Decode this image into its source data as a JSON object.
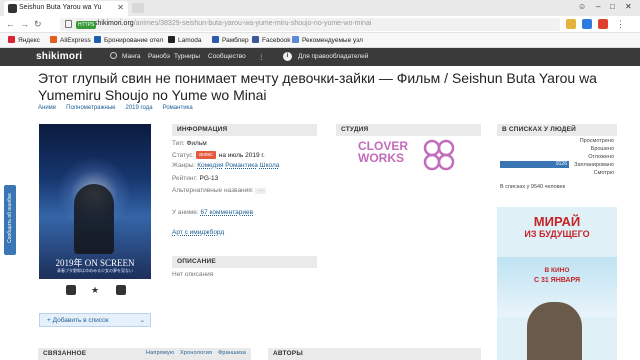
{
  "browser": {
    "tab_title": "Seishun Buta Yarou wa Yu",
    "url_https": "HTTPS",
    "url_domain": "shikimori.org",
    "url_path": "/animes/38329-seishun-buta-yarou-wa-yume-miru-shoujo-no-yume-wo-minai",
    "bookmarks": [
      "Яндекс",
      "AliExpress",
      "Бронирование отел",
      "Lamoda",
      "Рамблер",
      "Facebook",
      "Рекомендуемые узл"
    ],
    "bookmark_colors": [
      "#d23",
      "#e85c1c",
      "#1b5fae",
      "#222",
      "#2a5caa",
      "#3b5998",
      "#5a8bd6"
    ]
  },
  "site": {
    "logo": "shikimori",
    "nav": [
      "Манга",
      "Ранобэ",
      "Турниры",
      "Сообщество"
    ],
    "info_label": "Для правообладателей"
  },
  "anime": {
    "title": "Этот глупый свин не понимает мечту девочки-зайки — Фильм  /  Seishun Buta Yarou wa Yumemiru Shoujo no Yume wo Minai",
    "breadcrumbs": [
      "Аниме",
      "Полнометражные",
      "2019 года",
      "Романтика"
    ],
    "poster_title": "2019年 ON SCREEN",
    "poster_subtitle": "青春ブタ野郎はゆめみる少女の夢を見ない"
  },
  "info": {
    "heading": "ИНФОРМАЦИЯ",
    "type_label": "Тип:",
    "type_value": "Фильм",
    "status_label": "Статус:",
    "status_badge": "анонс",
    "status_value": "на июль 2019 г.",
    "genres_label": "Жанры:",
    "genres": [
      "Комедия",
      "Романтика",
      "Школа"
    ],
    "rating_label": "Рейтинг:",
    "rating_value": "PG-13",
    "alt_label": "Альтернативные названия:",
    "alt_button": "···",
    "user_label": "У аниме:",
    "comments": "67 комментариев",
    "art_link": "Арт с имиджборд"
  },
  "description": {
    "heading": "ОПИСАНИЕ",
    "text": "Нет описания"
  },
  "studio": {
    "heading": "СТУДИЯ",
    "name_line1": "CLOVER",
    "name_line2": "WORKS"
  },
  "user_lists": {
    "heading": "В СПИСКАХ У ЛЮДЕЙ",
    "items": [
      "Просмотрено",
      "Брошено",
      "Отложено",
      "Запланировано",
      "Смотрю"
    ],
    "planned_count": "9126",
    "planned_fraction": 0.96,
    "total": "В списках у 9540 человек"
  },
  "actions": {
    "add_to_list": "Добавить в список",
    "feedback": "Сообщить об ошибке"
  },
  "related": {
    "heading": "СВЯЗАННОЕ",
    "tabs": [
      "Напрямую",
      "Хронология",
      "Франшиза"
    ]
  },
  "authors": {
    "heading": "АВТОРЫ"
  },
  "ad": {
    "title_line1": "МИРАЙ",
    "title_line2": "ИЗ БУДУЩЕГО",
    "release_line1": "В КИНО",
    "release_line2": "С 31 ЯНВАРЯ"
  }
}
